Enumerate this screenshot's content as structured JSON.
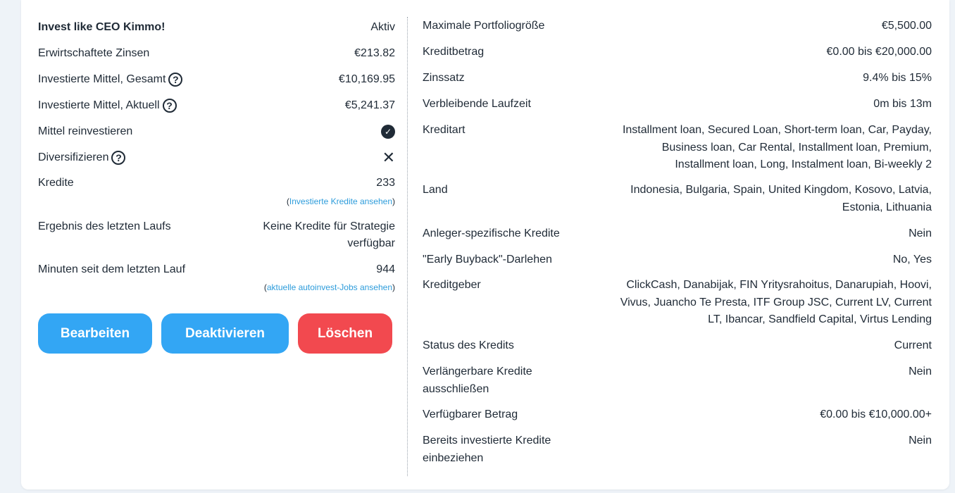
{
  "strategy": {
    "title": "Invest like CEO Kimmo!",
    "status": "Aktiv",
    "earned_interest_label": "Erwirtschaftete Zinsen",
    "earned_interest_value": "€213.82",
    "invested_total_label": "Investierte Mittel, Gesamt",
    "invested_total_value": "€10,169.95",
    "invested_current_label": "Investierte Mittel, Aktuell",
    "invested_current_value": "€5,241.37",
    "reinvest_label": "Mittel reinvestieren",
    "diversify_label": "Diversifizieren",
    "loans_label": "Kredite",
    "loans_value": "233",
    "loans_link_open": "(",
    "loans_link": "Investierte Kredite ansehen",
    "loans_link_close": ")",
    "last_run_label": "Ergebnis des letzten Laufs",
    "last_run_value_1": "Keine Kredite für Strategie",
    "last_run_value_2": "verfügbar",
    "minutes_label": "Minuten seit dem letzten Lauf",
    "minutes_value": "944",
    "jobs_link_open": "(",
    "jobs_link": "aktuelle autoinvest-Jobs ansehen",
    "jobs_link_close": ")",
    "help_glyph": "?",
    "check_icon": "check-circle-icon",
    "x_icon": "close-icon"
  },
  "buttons": {
    "edit": "Bearbeiten",
    "deactivate": "Deaktivieren",
    "delete": "Löschen"
  },
  "criteria": [
    {
      "label": "Maximale Portfoliogröße",
      "value": "€5,500.00"
    },
    {
      "label": "Kreditbetrag",
      "value": "€0.00 bis €20,000.00"
    },
    {
      "label": "Zinssatz",
      "value": "9.4% bis 15%"
    },
    {
      "label": "Verbleibende Laufzeit",
      "value": "0m bis 13m"
    },
    {
      "label": "Kreditart",
      "value_lines": [
        "Installment loan, Secured Loan, Short-term loan, Car, Payday,",
        "Business loan, Car Rental, Installment loan, Premium,",
        "Installment loan, Long, Instalment loan, Bi-weekly 2"
      ]
    },
    {
      "label": "Land",
      "value_lines": [
        "Indonesia, Bulgaria, Spain, United Kingdom, Kosovo, Latvia,",
        "Estonia, Lithuania"
      ]
    },
    {
      "label": "Anleger-spezifische Kredite",
      "value": "Nein"
    },
    {
      "label": "\"Early Buyback\"-Darlehen",
      "value": "No, Yes"
    },
    {
      "label": "Kreditgeber",
      "value_lines": [
        "ClickCash, Danabijak, FIN Yritysrahoitus, Danarupiah, Hoovi,",
        "Vivus, Juancho Te Presta, ITF Group JSC, Current LV, Current",
        "LT, Ibancar, Sandfield Capital, Virtus Lending"
      ]
    },
    {
      "label": "Status des Kredits",
      "value": "Current"
    },
    {
      "label_lines": [
        "Verlängerbare Kredite",
        "ausschließen"
      ],
      "value": "Nein"
    },
    {
      "label": "Verfügbarer Betrag",
      "value": "€0.00 bis €10,000.00+"
    },
    {
      "label_lines": [
        "Bereits investierte Kredite",
        "einbeziehen"
      ],
      "value": "Nein"
    }
  ]
}
